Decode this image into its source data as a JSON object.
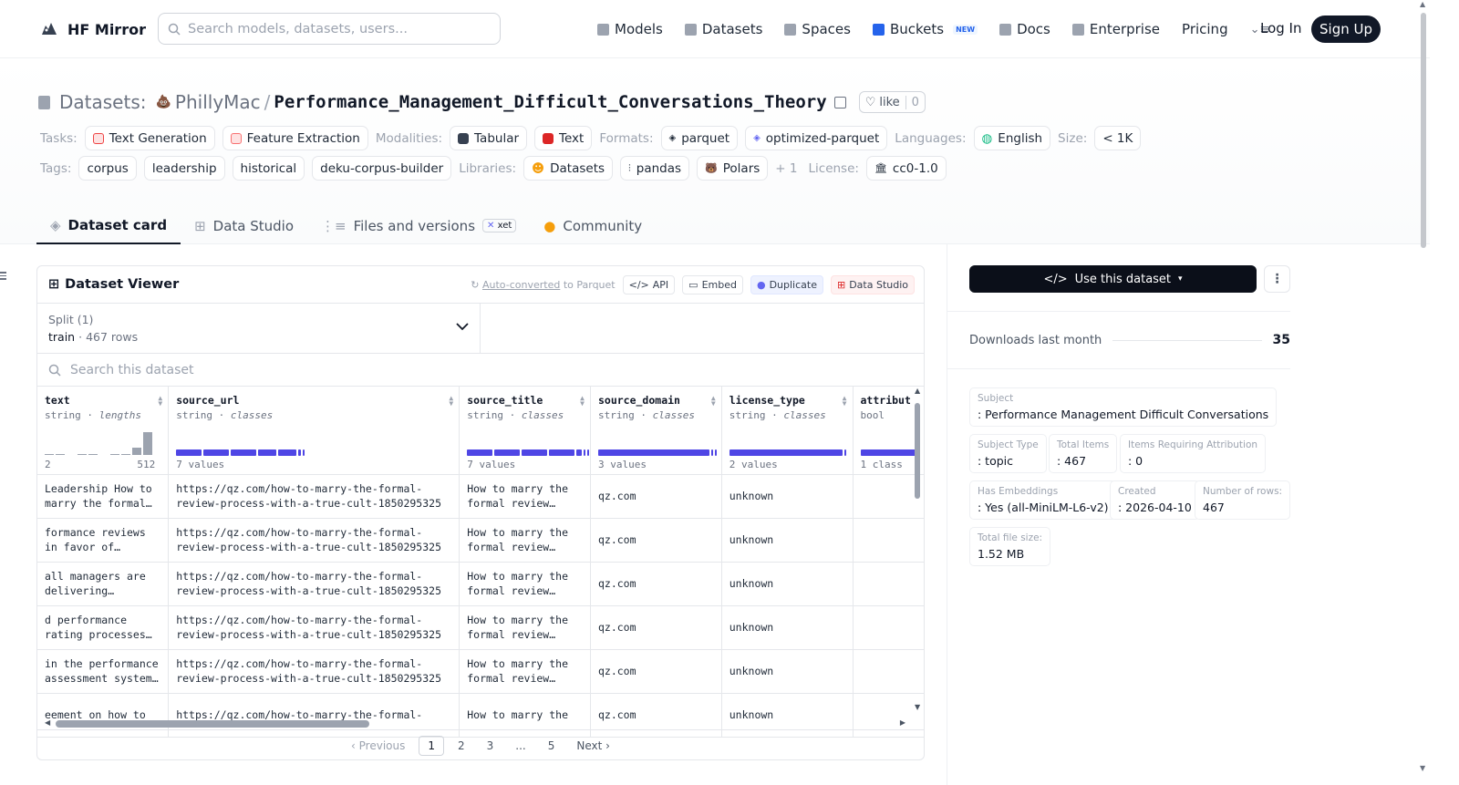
{
  "nav": {
    "brand": "HF Mirror",
    "search_placeholder": "Search models, datasets, users...",
    "items": [
      {
        "label": "Models",
        "icon": "models-icon",
        "color": "#9ca3af"
      },
      {
        "label": "Datasets",
        "icon": "datasets-icon",
        "color": "#9ca3af"
      },
      {
        "label": "Spaces",
        "icon": "spaces-icon",
        "color": "#9ca3af"
      },
      {
        "label": "Buckets",
        "icon": "buckets-icon",
        "color": "#2563eb"
      },
      {
        "label": "Docs",
        "icon": "docs-icon",
        "color": "#9ca3af"
      },
      {
        "label": "Enterprise",
        "icon": "enterprise-icon",
        "color": "#9ca3af"
      },
      {
        "label": "Pricing"
      }
    ],
    "new_badge": "NEW",
    "login": "Log In",
    "signup": "Sign Up"
  },
  "header": {
    "datasets_label": "Datasets:",
    "owner": "PhillyMac",
    "separator": "/",
    "dataset_name": "Performance_Management_Difficult_Conversations_Theory",
    "like_label": "like",
    "like_count": "0",
    "tasks_label": "Tasks:",
    "tasks": [
      "Text Generation",
      "Feature Extraction"
    ],
    "modalities_label": "Modalities:",
    "modalities": [
      "Tabular",
      "Text"
    ],
    "formats_label": "Formats:",
    "formats": [
      "parquet",
      "optimized-parquet"
    ],
    "languages_label": "Languages:",
    "languages": [
      "English"
    ],
    "size_label": "Size:",
    "size": "< 1K",
    "tags_label": "Tags:",
    "tags": [
      "corpus",
      "leadership",
      "historical",
      "deku-corpus-builder"
    ],
    "libraries_label": "Libraries:",
    "libraries": [
      "Datasets",
      "pandas",
      "Polars"
    ],
    "libraries_more": "+ 1",
    "license_label": "License:",
    "license": "cc0-1.0"
  },
  "tabs": [
    {
      "label": "Dataset card",
      "active": true
    },
    {
      "label": "Data Studio"
    },
    {
      "label": "Files and versions",
      "badge": "xet"
    },
    {
      "label": "Community"
    }
  ],
  "viewer": {
    "title": "Dataset Viewer",
    "auto_converted": "Auto-converted",
    "to_parquet": " to Parquet",
    "buttons": [
      "API",
      "Embed",
      "Duplicate",
      "Data Studio"
    ],
    "split_label": "Split (1)",
    "split_name": "train",
    "split_rows": "467 rows",
    "search_placeholder": "Search this dataset",
    "columns": [
      {
        "name": "text",
        "type": "string",
        "stat": "lengths",
        "min": "2",
        "max": "512"
      },
      {
        "name": "source_url",
        "type": "string",
        "stat": "classes",
        "summary": "7 values"
      },
      {
        "name": "source_title",
        "type": "string",
        "stat": "classes",
        "summary": "7 values"
      },
      {
        "name": "source_domain",
        "type": "string",
        "stat": "classes",
        "summary": "3 values"
      },
      {
        "name": "license_type",
        "type": "string",
        "stat": "classes",
        "summary": "2 values"
      },
      {
        "name": "attribut",
        "type": "bool",
        "stat": "",
        "summary": "1 class"
      }
    ],
    "rows": [
      [
        "Leadership How to marry the formal…",
        "https://qz.com/how-to-marry-the-formal-review-process-with-a-true-cult-1850295325",
        "How to marry the formal review…",
        "qz.com",
        "unknown",
        ""
      ],
      [
        "formance reviews in favor of…",
        "https://qz.com/how-to-marry-the-formal-review-process-with-a-true-cult-1850295325",
        "How to marry the formal review…",
        "qz.com",
        "unknown",
        ""
      ],
      [
        "all managers are delivering…",
        "https://qz.com/how-to-marry-the-formal-review-process-with-a-true-cult-1850295325",
        "How to marry the formal review…",
        "qz.com",
        "unknown",
        ""
      ],
      [
        "d performance rating processes…",
        "https://qz.com/how-to-marry-the-formal-review-process-with-a-true-cult-1850295325",
        "How to marry the formal review…",
        "qz.com",
        "unknown",
        ""
      ],
      [
        "in the performance assessment system…",
        "https://qz.com/how-to-marry-the-formal-review-process-with-a-true-cult-1850295325",
        "How to marry the formal review…",
        "qz.com",
        "unknown",
        ""
      ],
      [
        "eement on how to",
        "https://qz.com/how-to-marry-the-formal-",
        "How to marry the",
        "qz.com",
        "unknown",
        ""
      ]
    ],
    "pagination": {
      "prev": "Previous",
      "pages": [
        "1",
        "2",
        "3",
        "...",
        "5"
      ],
      "next": "Next",
      "current": "1"
    }
  },
  "sidebar": {
    "use_dataset": "Use this dataset",
    "downloads_label": "Downloads last month",
    "downloads_value": "35",
    "meta": [
      {
        "k": "Subject",
        "v": ": Performance Management Difficult Conversations"
      },
      {
        "k": "Subject Type",
        "v": ": topic"
      },
      {
        "k": "Total Items",
        "v": ": 467"
      },
      {
        "k": "Items Requiring Attribution",
        "v": ": 0"
      },
      {
        "k": "Has Embeddings",
        "v": ": Yes (all-MiniLM-L6-v2)"
      },
      {
        "k": "Created",
        "v": ": 2026-04-10"
      },
      {
        "k": "Number of rows:",
        "v": "467"
      },
      {
        "k": "Total file size:",
        "v": "1.52 MB"
      }
    ]
  }
}
